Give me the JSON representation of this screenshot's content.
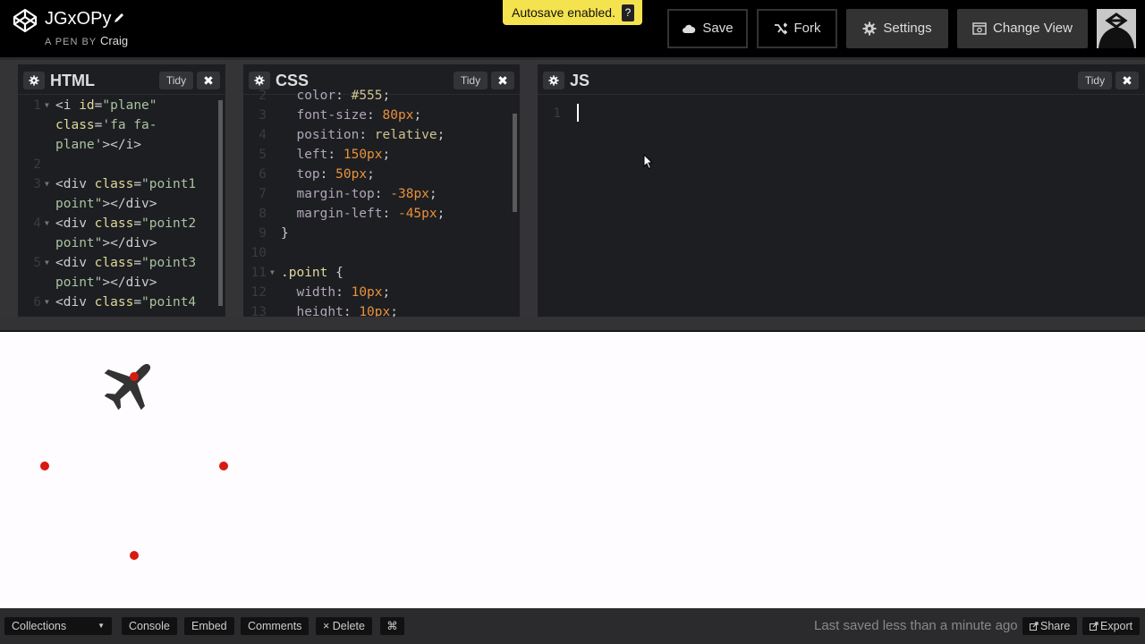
{
  "header": {
    "pen_title": "JGxOPy",
    "pen_by_label": "A PEN BY",
    "author": "Craig",
    "autosave_text": "Autosave enabled.",
    "autosave_help": "?",
    "buttons": {
      "save": "Save",
      "fork": "Fork",
      "settings": "Settings",
      "change_view": "Change View"
    }
  },
  "editors": {
    "html": {
      "title": "HTML",
      "tidy": "Tidy",
      "close": "✖",
      "lines": [
        {
          "num": "1",
          "fold": true,
          "parts": [
            [
              "t-tag",
              "<i "
            ],
            [
              "t-attr",
              "id"
            ],
            [
              "t-punct",
              "="
            ],
            [
              "t-str",
              "\"plane\""
            ]
          ]
        },
        {
          "num": "",
          "fold": false,
          "parts": [
            [
              "t-attr",
              "class"
            ],
            [
              "t-punct",
              "="
            ],
            [
              "t-str",
              "'fa fa-"
            ]
          ]
        },
        {
          "num": "",
          "fold": false,
          "parts": [
            [
              "t-str",
              "plane'"
            ],
            [
              "t-tag",
              "></i>"
            ]
          ]
        },
        {
          "num": "2",
          "fold": false,
          "parts": []
        },
        {
          "num": "3",
          "fold": true,
          "parts": [
            [
              "t-tag",
              "<div "
            ],
            [
              "t-attr",
              "class"
            ],
            [
              "t-punct",
              "="
            ],
            [
              "t-str",
              "\"point1"
            ]
          ]
        },
        {
          "num": "",
          "fold": false,
          "parts": [
            [
              "t-str",
              "point\""
            ],
            [
              "t-tag",
              "></div>"
            ]
          ]
        },
        {
          "num": "4",
          "fold": true,
          "parts": [
            [
              "t-tag",
              "<div "
            ],
            [
              "t-attr",
              "class"
            ],
            [
              "t-punct",
              "="
            ],
            [
              "t-str",
              "\"point2"
            ]
          ]
        },
        {
          "num": "",
          "fold": false,
          "parts": [
            [
              "t-str",
              "point\""
            ],
            [
              "t-tag",
              "></div>"
            ]
          ]
        },
        {
          "num": "5",
          "fold": true,
          "parts": [
            [
              "t-tag",
              "<div "
            ],
            [
              "t-attr",
              "class"
            ],
            [
              "t-punct",
              "="
            ],
            [
              "t-str",
              "\"point3"
            ]
          ]
        },
        {
          "num": "",
          "fold": false,
          "parts": [
            [
              "t-str",
              "point\""
            ],
            [
              "t-tag",
              "></div>"
            ]
          ]
        },
        {
          "num": "6",
          "fold": true,
          "parts": [
            [
              "t-tag",
              "<div "
            ],
            [
              "t-attr",
              "class"
            ],
            [
              "t-punct",
              "="
            ],
            [
              "t-str",
              "\"point4"
            ]
          ]
        }
      ]
    },
    "css": {
      "title": "CSS",
      "tidy": "Tidy",
      "close": "✖",
      "lines": [
        {
          "num": "2",
          "fold": false,
          "indent": "  ",
          "parts": [
            [
              "t-prop",
              "color"
            ],
            [
              "t-punct",
              ": "
            ],
            [
              "t-kw",
              "#555"
            ],
            [
              "t-punct",
              ";"
            ]
          ]
        },
        {
          "num": "3",
          "fold": false,
          "indent": "  ",
          "parts": [
            [
              "t-prop",
              "font-size"
            ],
            [
              "t-punct",
              ": "
            ],
            [
              "t-num",
              "80px"
            ],
            [
              "t-punct",
              ";"
            ]
          ]
        },
        {
          "num": "4",
          "fold": false,
          "indent": "  ",
          "parts": [
            [
              "t-prop",
              "position"
            ],
            [
              "t-punct",
              ": "
            ],
            [
              "t-kw",
              "relative"
            ],
            [
              "t-punct",
              ";"
            ]
          ]
        },
        {
          "num": "5",
          "fold": false,
          "indent": "  ",
          "parts": [
            [
              "t-prop",
              "left"
            ],
            [
              "t-punct",
              ": "
            ],
            [
              "t-num",
              "150px"
            ],
            [
              "t-punct",
              ";"
            ]
          ]
        },
        {
          "num": "6",
          "fold": false,
          "indent": "  ",
          "parts": [
            [
              "t-prop",
              "top"
            ],
            [
              "t-punct",
              ": "
            ],
            [
              "t-num",
              "50px"
            ],
            [
              "t-punct",
              ";"
            ]
          ]
        },
        {
          "num": "7",
          "fold": false,
          "indent": "  ",
          "parts": [
            [
              "t-prop",
              "margin-top"
            ],
            [
              "t-punct",
              ": "
            ],
            [
              "t-num",
              "-38px"
            ],
            [
              "t-punct",
              ";"
            ]
          ]
        },
        {
          "num": "8",
          "fold": false,
          "indent": "  ",
          "parts": [
            [
              "t-prop",
              "margin-left"
            ],
            [
              "t-punct",
              ": "
            ],
            [
              "t-num",
              "-45px"
            ],
            [
              "t-punct",
              ";"
            ]
          ]
        },
        {
          "num": "9",
          "fold": false,
          "indent": "",
          "parts": [
            [
              "t-punct",
              "}"
            ]
          ]
        },
        {
          "num": "10",
          "fold": false,
          "indent": "",
          "parts": []
        },
        {
          "num": "11",
          "fold": true,
          "indent": "",
          "parts": [
            [
              "t-sel",
              ".point"
            ],
            [
              "t-punct",
              " {"
            ]
          ]
        },
        {
          "num": "12",
          "fold": false,
          "indent": "  ",
          "parts": [
            [
              "t-prop",
              "width"
            ],
            [
              "t-punct",
              ": "
            ],
            [
              "t-num",
              "10px"
            ],
            [
              "t-punct",
              ";"
            ]
          ]
        },
        {
          "num": "13",
          "fold": false,
          "indent": "  ",
          "parts": [
            [
              "t-prop",
              "height"
            ],
            [
              "t-punct",
              ": "
            ],
            [
              "t-num",
              "10px"
            ],
            [
              "t-punct",
              ";"
            ]
          ]
        }
      ]
    },
    "js": {
      "title": "JS",
      "tidy": "Tidy",
      "close": "✖",
      "lines": [
        {
          "num": "1",
          "fold": false,
          "parts": []
        }
      ]
    }
  },
  "preview": {
    "plane_icon": "fa-plane",
    "plane_color": "#333333",
    "point_color": "#d81a10"
  },
  "footer": {
    "collections": "Collections",
    "console": "Console",
    "embed": "Embed",
    "comments": "Comments",
    "delete": "× Delete",
    "shortcut": "⌘",
    "last_saved": "Last saved less than a minute ago",
    "share": "Share",
    "export": "Export"
  }
}
